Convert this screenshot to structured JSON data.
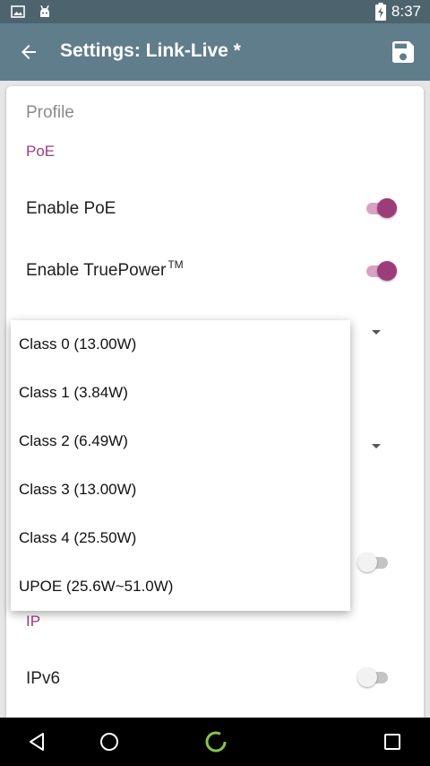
{
  "status_bar": {
    "time": "8:37",
    "left_icons": [
      "image-notification-icon",
      "android-notification-icon"
    ],
    "battery_icon": "battery-charging-icon"
  },
  "app_bar": {
    "title": "Settings: Link-Live *",
    "back_icon": "arrow-back-icon",
    "save_icon": "save-icon"
  },
  "settings": {
    "profile_label": "Profile",
    "poe_section": "PoE",
    "enable_poe": {
      "label": "Enable PoE",
      "enabled": true
    },
    "enable_truepower": {
      "label": "Enable TruePower",
      "trademark": "TM",
      "enabled": true
    },
    "hidden_toggle": {
      "enabled": false
    },
    "ip_section": "IP",
    "ipv6": {
      "label": "IPv6",
      "enabled": false
    }
  },
  "dropdown": {
    "options": [
      "Class 0 (13.00W)",
      "Class 1 (3.84W)",
      "Class 2 (6.49W)",
      "Class 3 (13.00W)",
      "Class 4 (25.50W)",
      "UPOE (25.6W~51.0W)"
    ]
  },
  "colors": {
    "accent": "#9c3d7a",
    "app_bar": "#607d8b",
    "status_bar": "#4d636e",
    "nav_home_accent": "#8bc34a"
  },
  "nav_bar": {
    "back_icon": "nav-back-icon",
    "home_icon": "nav-home-icon",
    "assistant_icon": "assistant-ring-icon",
    "recents_icon": "nav-recents-icon"
  }
}
